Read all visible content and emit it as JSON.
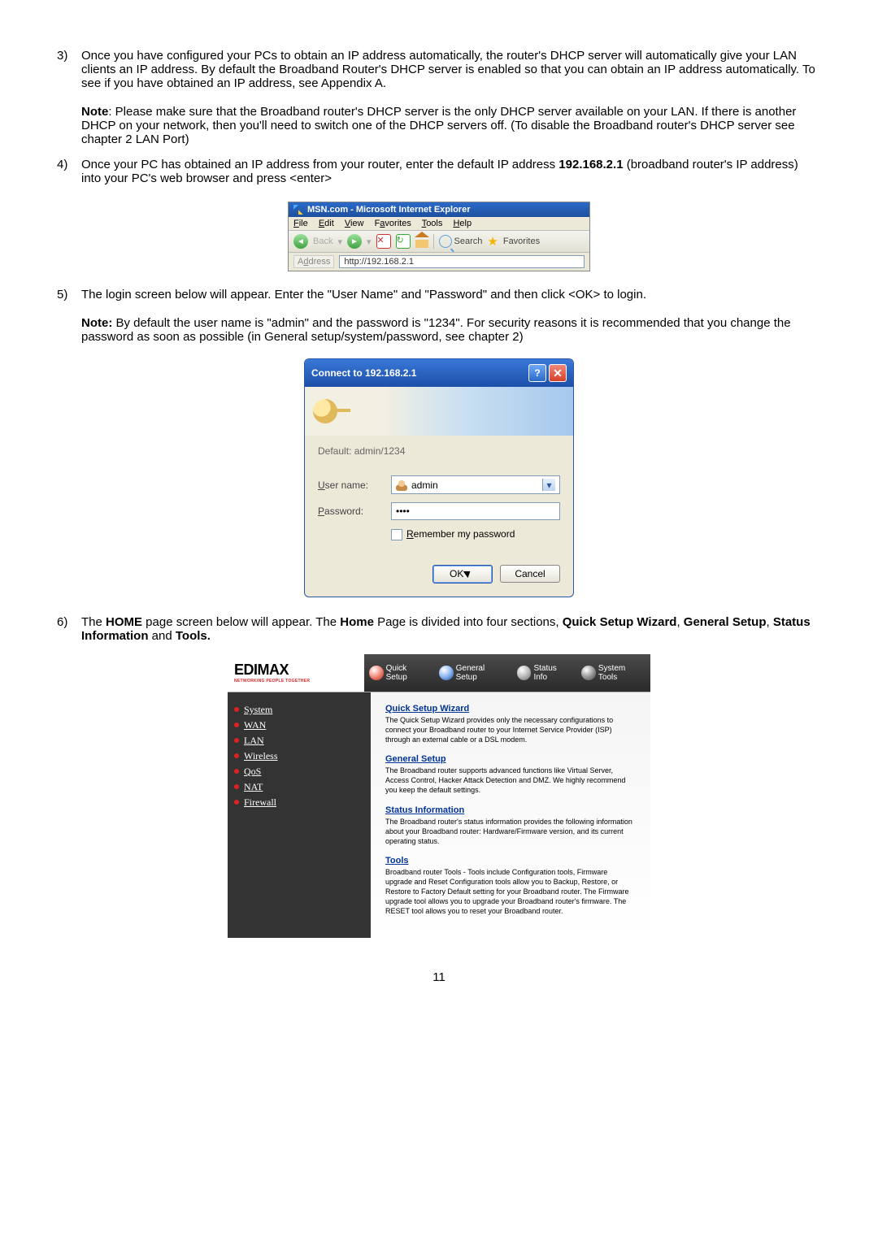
{
  "step3": {
    "num": "3)",
    "text": "Once you have configured your PCs to obtain an IP address automatically, the router's DHCP server will automatically give your LAN clients an IP address. By default the Broadband Router's DHCP server is enabled so that you can obtain an IP address automatically. To see if you have obtained an IP address, see Appendix A.",
    "noteLabel": "Note",
    "noteText": ": Please make sure that the Broadband router's DHCP server is the only DHCP server available on your LAN. If there is another DHCP on your network, then you'll need to switch one of the DHCP servers off. (To disable the Broadband router's DHCP server see chapter 2 LAN Port)"
  },
  "step4": {
    "num": "4)",
    "textA": "Once your PC has obtained an IP address from your router, enter the default IP address ",
    "ip": "192.168.2.1",
    "textB": " (broadband router's IP address) into your PC's web browser and press <enter>"
  },
  "ieBar": {
    "title": "MSN.com - Microsoft Internet Explorer",
    "menu": {
      "file": "File",
      "edit": "Edit",
      "view": "View",
      "fav": "Favorites",
      "tools": "Tools",
      "help": "Help"
    },
    "toolbar": {
      "back": "Back",
      "search": "Search",
      "favorites": "Favorites"
    },
    "addressLabel": "Address",
    "url": "http://192.168.2.1"
  },
  "step5": {
    "num": "5)",
    "text": "The login screen below will appear. Enter the \"User Name\" and \"Password\" and then click <OK> to login.",
    "noteLabel": "Note:",
    "noteText": " By default the user name is \"admin\" and the password is \"1234\". For security reasons it is recommended that you change the password as soon as possible (in General setup/system/password, see chapter 2)"
  },
  "login": {
    "title": "Connect to 192.168.2.1",
    "default": "Default: admin/1234",
    "userLabel": "User name:",
    "userValue": "admin",
    "passLabel": "Password:",
    "passValue": "••••",
    "remember": "Remember my password",
    "ok": "OK",
    "cancel": "Cancel"
  },
  "step6": {
    "num": "6)",
    "a": "The ",
    "b": "HOME",
    "c": " page screen below will appear. The ",
    "d": "Home",
    "e": " Page is divided into four sections, ",
    "f": "Quick Setup Wizard",
    "g": ", ",
    "h": "General Setup",
    "i": ", ",
    "j": "Status Information",
    "k": " and ",
    "l": "Tools.",
    "m": ""
  },
  "home": {
    "brand": "EDIMAX",
    "brandTag": "NETWORKING PEOPLE TOGETHER",
    "tabs": {
      "quick": "Quick Setup",
      "general": "General Setup",
      "status": "Status Info",
      "tools": "System Tools"
    },
    "side": [
      "System",
      "WAN",
      "LAN",
      "Wireless",
      "QoS",
      "NAT",
      "Firewall"
    ],
    "sections": [
      {
        "title": "Quick Setup Wizard",
        "body": "The Quick Setup Wizard provides only the necessary configurations to connect your Broadband router to your Internet Service Provider (ISP) through an external cable or a DSL modem."
      },
      {
        "title": "General Setup",
        "body": "The Broadband router supports advanced functions like Virtual Server, Access Control, Hacker Attack Detection and DMZ. We highly recommend you keep the default settings."
      },
      {
        "title": "Status Information",
        "body": "The Broadband router's status information provides the following information about your Broadband router: Hardware/Firmware version, and its current operating status."
      },
      {
        "title": "Tools",
        "body": "Broadband router Tools - Tools include Configuration tools, Firmware upgrade and Reset Configuration tools allow you to Backup, Restore, or Restore to Factory Default setting for your Broadband router. The Firmware upgrade tool allows you to upgrade your Broadband router's firmware. The RESET tool allows you to reset your Broadband router."
      }
    ]
  },
  "pageNumber": "11"
}
